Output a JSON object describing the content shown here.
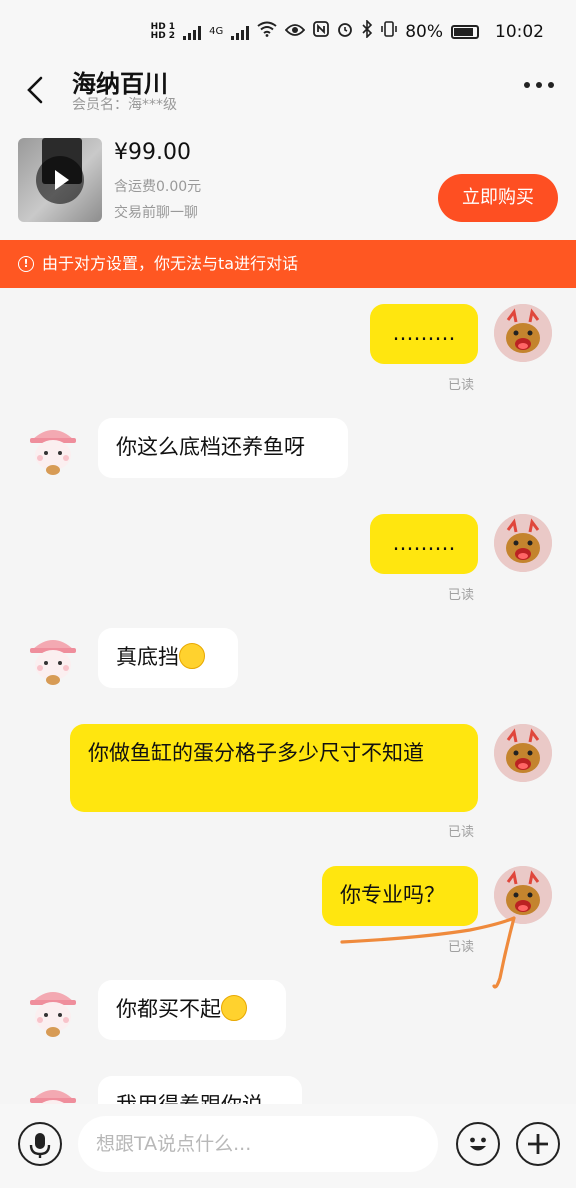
{
  "status_bar": {
    "network": "4G",
    "battery": "80%",
    "time": "10:02"
  },
  "header": {
    "title": "海纳百川",
    "member_level": "会员名：海***级"
  },
  "product": {
    "price": "¥99.00",
    "shipping": "含运费0.00元",
    "hint": "交易前聊一聊",
    "buy_label": "立即购买"
  },
  "banner": {
    "text": "由于对方设置，你无法与ta进行对话"
  },
  "messages": [
    {
      "from": "me",
      "text": "………",
      "status": "已读"
    },
    {
      "from": "them",
      "text": "你这么底档还养鱼呀"
    },
    {
      "from": "me",
      "text": "………",
      "status": "已读"
    },
    {
      "from": "them",
      "text": "真底挡",
      "emoji": "rolling-eyes"
    },
    {
      "from": "me",
      "text": "你做鱼缸的蛋分格子多少尺寸不知道",
      "status": "已读"
    },
    {
      "from": "me",
      "text": "你专业吗？",
      "status": "已读"
    },
    {
      "from": "them",
      "text": "你都买不起",
      "emoji": "grin"
    },
    {
      "from": "them",
      "text": "我用得着跟你说"
    }
  ],
  "input": {
    "placeholder": "想跟TA说点什么..."
  },
  "colors": {
    "accent": "#fe4f22",
    "my_bubble": "#ffe60f",
    "banner": "#ff5722"
  }
}
